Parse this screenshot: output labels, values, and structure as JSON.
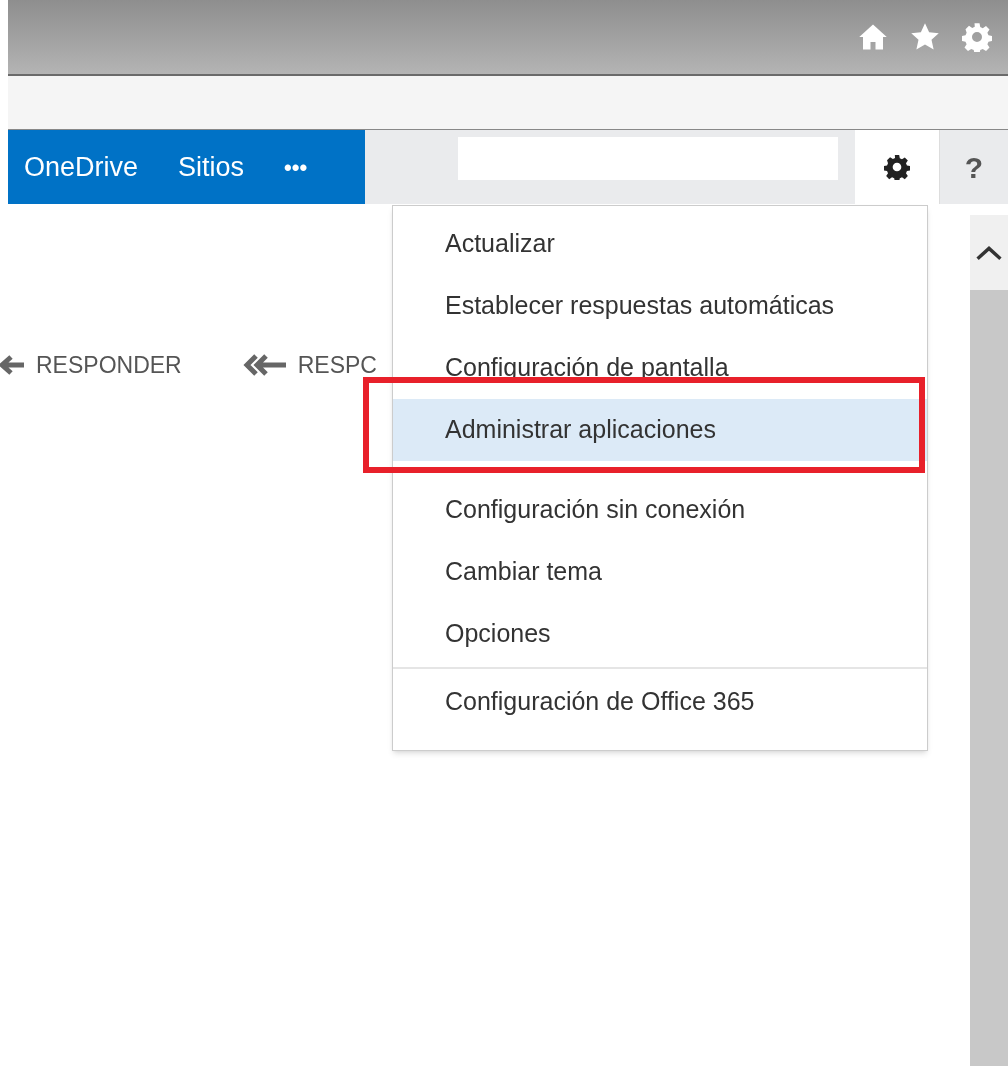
{
  "nav": {
    "links": [
      "OneDrive",
      "Sitios"
    ],
    "more": "•••",
    "help": "?"
  },
  "toolbar": [
    {
      "label": "RESPONDER",
      "kind": "single"
    },
    {
      "label": "RESPC",
      "kind": "double"
    }
  ],
  "menu": {
    "groups": [
      {
        "divider": false,
        "items": [
          {
            "label": "Actualizar",
            "selected": false
          },
          {
            "label": "Establecer respuestas automáticas",
            "selected": false
          },
          {
            "label": "Configuración de pantalla",
            "selected": false
          },
          {
            "label": "Administrar aplicaciones",
            "selected": true
          }
        ]
      },
      {
        "divider": false,
        "items": [
          {
            "label": "Configuración sin conexión",
            "selected": false
          },
          {
            "label": "Cambiar tema",
            "selected": false
          },
          {
            "label": "Opciones",
            "selected": false
          }
        ]
      },
      {
        "divider": true,
        "items": [
          {
            "label": "Configuración de Office 365",
            "selected": false
          }
        ]
      }
    ]
  }
}
